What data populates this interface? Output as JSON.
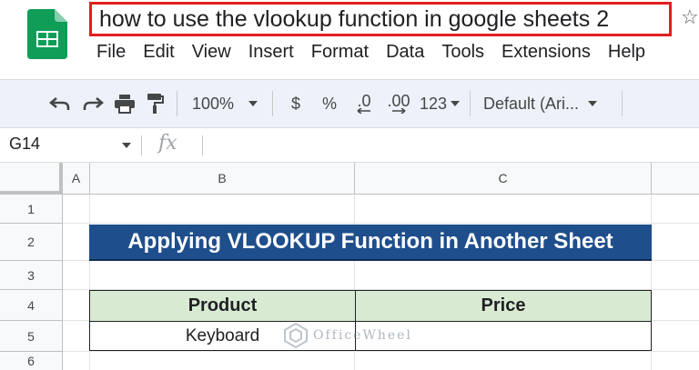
{
  "document": {
    "title": "how to use the vlookup function in google sheets 2"
  },
  "menu": [
    "File",
    "Edit",
    "View",
    "Insert",
    "Format",
    "Data",
    "Tools",
    "Extensions",
    "Help"
  ],
  "toolbar": {
    "zoom": "100%",
    "currency": "$",
    "percent": "%",
    "decrease_decimal": ".0",
    "increase_decimal": ".00",
    "number_format": "123",
    "font": "Default (Ari..."
  },
  "formula_bar": {
    "cell_ref": "G14",
    "fx": "fx",
    "value": ""
  },
  "sheet": {
    "columns": [
      "A",
      "B",
      "C"
    ],
    "rows": [
      "1",
      "2",
      "3",
      "4",
      "5",
      "6"
    ],
    "banner": "Applying VLOOKUP Function in Another Sheet",
    "table_headers": [
      "Product",
      "Price"
    ],
    "table_rows": [
      [
        "Keyboard",
        ""
      ]
    ]
  },
  "watermark": "OfficeWheel",
  "colors": {
    "banner_bg": "#1f4e8c",
    "header_bg": "#d9ead3",
    "title_border": "#e0201e",
    "sheets_green": "#0f9d58"
  }
}
